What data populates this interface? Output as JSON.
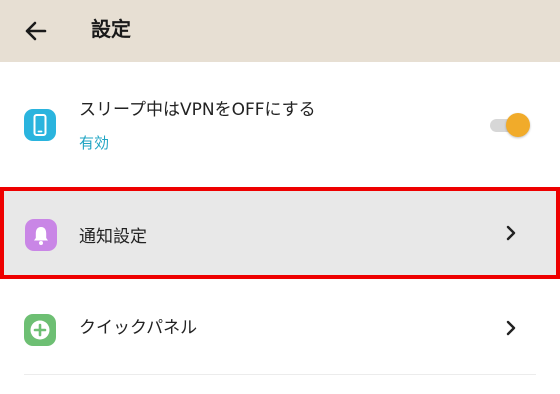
{
  "app_bar": {
    "title": "設定",
    "back_icon": "arrow-left-icon",
    "background": "#e7dfd3"
  },
  "settings": [
    {
      "id": "vpn-sleep",
      "icon": "smartphone-icon",
      "icon_color": "#2ab4de",
      "label": "スリープ中はVPNをOFFにする",
      "sublabel": "有効",
      "toggle_on": true,
      "toggle_color": "#f1ab2a"
    },
    {
      "id": "notification-settings",
      "icon": "bell-icon",
      "icon_color": "#c986e6",
      "label": "通知設定",
      "trailing": "chevron-right-icon",
      "highlighted": true,
      "highlight_color": "#ee0000"
    },
    {
      "id": "quick-panel",
      "icon": "plus-circle-icon",
      "icon_color": "#6dbf73",
      "label": "クイックパネル",
      "trailing": "chevron-right-icon"
    }
  ]
}
